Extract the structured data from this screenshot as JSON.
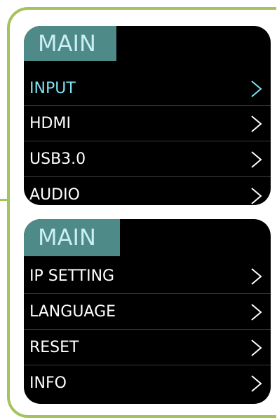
{
  "colors": {
    "frame": "#a4c35e",
    "panel_bg": "#000000",
    "title_bg": "#4e8a88",
    "title_text": "#cbeef2",
    "active_text": "#7fe3f2",
    "text": "#ffffff"
  },
  "menus": [
    {
      "title": "MAIN",
      "items": [
        {
          "label": "INPUT",
          "icon": "chevron-right-icon",
          "active": true
        },
        {
          "label": "HDMI",
          "icon": "chevron-right-icon"
        },
        {
          "label": "USB3.0",
          "icon": "chevron-right-icon"
        },
        {
          "label": "AUDIO",
          "icon": "chevron-right-icon"
        }
      ]
    },
    {
      "title": "MAIN",
      "items": [
        {
          "label": "IP SETTING",
          "icon": "chevron-right-icon"
        },
        {
          "label": "LANGUAGE",
          "icon": "chevron-right-icon"
        },
        {
          "label": "RESET",
          "icon": "chevron-right-icon"
        },
        {
          "label": "INFO",
          "icon": "chevron-right-icon"
        }
      ]
    }
  ]
}
